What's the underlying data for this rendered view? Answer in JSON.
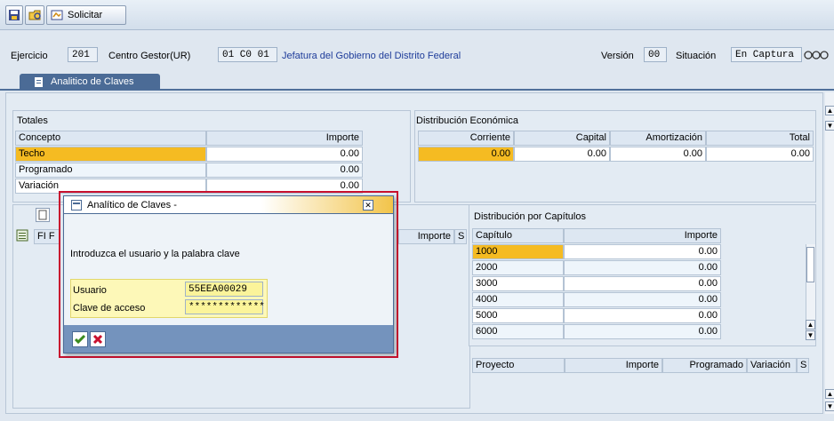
{
  "toolbar": {
    "solicitar_label": "Solicitar"
  },
  "header": {
    "ejercicio_label": "Ejercicio",
    "ejercicio_value": "201",
    "centro_label": "Centro Gestor(UR)",
    "centro_value": "01 C0 01",
    "centro_desc": "Jefatura del Gobierno del Distrito Federal",
    "version_label": "Versión",
    "version_value": "00",
    "situacion_label": "Situación",
    "situacion_value": "En Captura"
  },
  "tab": {
    "label": "Analitico de Claves"
  },
  "totales": {
    "title": "Totales",
    "col_concepto": "Concepto",
    "col_importe": "Importe",
    "rows": [
      {
        "concepto": "Techo",
        "importe": "0.00"
      },
      {
        "concepto": "Programado",
        "importe": "0.00"
      },
      {
        "concepto": "Variación",
        "importe": "0.00"
      }
    ]
  },
  "dist_econ": {
    "title": "Distribución Económica",
    "headers": [
      "Corriente",
      "Capital",
      "Amortización",
      "Total"
    ],
    "values": [
      "0.00",
      "0.00",
      "0.00",
      "0.00"
    ]
  },
  "lower_left": {
    "header_fi": "FI F",
    "header_importe": "Importe",
    "header_s": "S"
  },
  "dist_cap": {
    "title": "Distribución por Capítulos",
    "col_capitulo": "Capítulo",
    "col_importe": "Importe",
    "rows": [
      {
        "capitulo": "1000",
        "importe": "0.00"
      },
      {
        "capitulo": "2000",
        "importe": "0.00"
      },
      {
        "capitulo": "3000",
        "importe": "0.00"
      },
      {
        "capitulo": "4000",
        "importe": "0.00"
      },
      {
        "capitulo": "5000",
        "importe": "0.00"
      },
      {
        "capitulo": "6000",
        "importe": "0.00"
      }
    ]
  },
  "proyecto": {
    "headers": [
      "Proyecto",
      "Importe",
      "Programado",
      "Variación",
      "S"
    ]
  },
  "dialog": {
    "title": "Analítico de Claves -",
    "instruction": "Introduzca el usuario y la palabra clave",
    "usuario_label": "Usuario",
    "usuario_value": "55EEA00029",
    "clave_label": "Clave de acceso",
    "clave_value": "*************"
  },
  "colors": {
    "highlight_yellow": "#f5bb22",
    "dialog_border_red": "#c8102e",
    "field_yellow": "#fbf49a",
    "link_blue": "#1e3c9a"
  }
}
